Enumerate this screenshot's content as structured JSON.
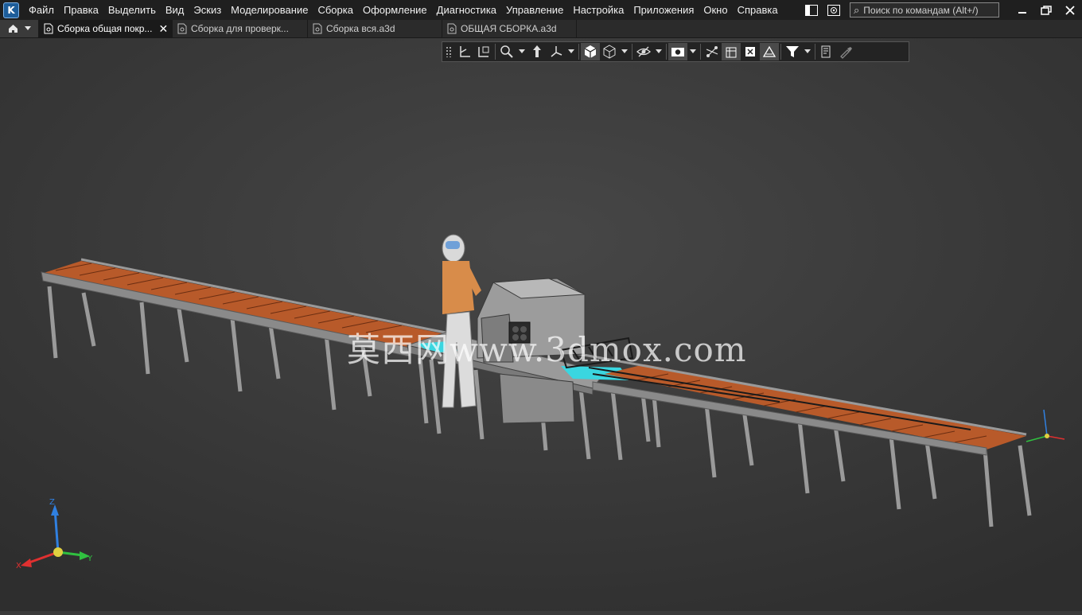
{
  "menu": {
    "items": [
      "Файл",
      "Правка",
      "Выделить",
      "Вид",
      "Эскиз",
      "Моделирование",
      "Сборка",
      "Оформление",
      "Диагностика",
      "Управление",
      "Настройка",
      "Приложения",
      "Окно",
      "Справка"
    ]
  },
  "search": {
    "placeholder": "Поиск по командам (Alt+/)"
  },
  "tabs": [
    {
      "label": "Сборка общая покр...",
      "active": true
    },
    {
      "label": "Сборка для проверк...",
      "active": false
    },
    {
      "label": "Сборка вся.a3d",
      "active": false
    },
    {
      "label": "ОБЩАЯ СБОРКА.a3d",
      "active": false
    }
  ],
  "watermark": {
    "text": "莫西网www.3dmox.com"
  },
  "triad": {
    "x_label": "X",
    "y_label": "Y",
    "z_label": "Z"
  },
  "colors": {
    "background": "#3a3a3a",
    "menubar": "#1f1f1f",
    "rollers": "#b85a2a",
    "frame": "#8a8a8a",
    "accent_cyan": "#3ad6e0",
    "axis_x": "#e03030",
    "axis_y": "#30c040",
    "axis_z": "#3080e0"
  }
}
